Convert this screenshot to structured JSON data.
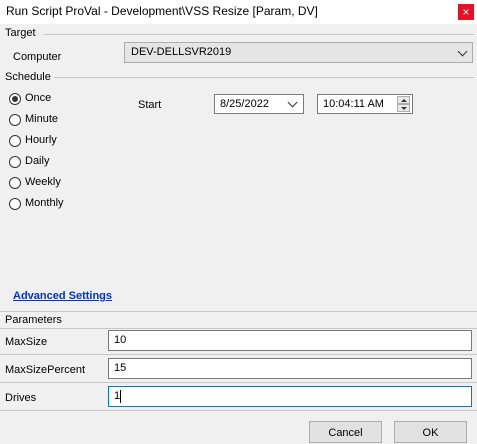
{
  "window": {
    "title": "Run Script ProVal - Development\\VSS Resize [Param, DV]",
    "close_glyph": "×"
  },
  "target": {
    "section_label": "Target",
    "computer_label": "Computer",
    "computer_value": "DEV-DELLSVR2019"
  },
  "schedule": {
    "section_label": "Schedule",
    "options": [
      "Once",
      "Minute",
      "Hourly",
      "Daily",
      "Weekly",
      "Monthly"
    ],
    "selected": "Once",
    "start_label": "Start",
    "start_date": "8/25/2022",
    "start_time": "10:04:11 AM"
  },
  "advanced_settings_label": "Advanced Settings",
  "parameters": {
    "section_label": "Parameters",
    "fields": [
      {
        "label": "MaxSize",
        "value": "10"
      },
      {
        "label": "MaxSizePercent",
        "value": "15"
      },
      {
        "label": "Drives",
        "value": "1"
      }
    ]
  },
  "buttons": {
    "cancel": "Cancel",
    "ok": "OK"
  },
  "colors": {
    "close_button": "#e81123",
    "link": "#0033cc",
    "focus_border": "#0078d7"
  },
  "icons": [
    "close-icon",
    "chevron-down-icon",
    "spin-up-icon",
    "spin-down-icon"
  ]
}
